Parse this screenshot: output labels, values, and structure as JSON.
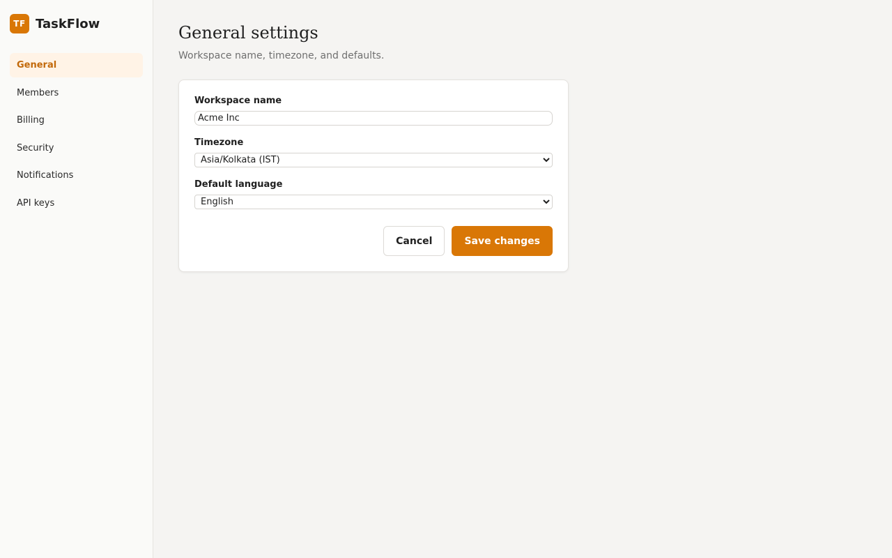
{
  "brand": {
    "logo_text": "TF",
    "name": "TaskFlow",
    "accent_color": "#d97706"
  },
  "sidebar": {
    "items": [
      {
        "label": "General",
        "active": true
      },
      {
        "label": "Members",
        "active": false
      },
      {
        "label": "Billing",
        "active": false
      },
      {
        "label": "Security",
        "active": false
      },
      {
        "label": "Notifications",
        "active": false
      },
      {
        "label": "API keys",
        "active": false
      }
    ]
  },
  "page": {
    "title": "General settings",
    "subtitle": "Workspace name, timezone, and defaults."
  },
  "form": {
    "workspace_name": {
      "label": "Workspace name",
      "value": "Acme Inc"
    },
    "timezone": {
      "label": "Timezone",
      "selected": "Asia/Kolkata (IST)"
    },
    "language": {
      "label": "Default language",
      "selected": "English"
    }
  },
  "actions": {
    "cancel_label": "Cancel",
    "save_label": "Save changes"
  }
}
